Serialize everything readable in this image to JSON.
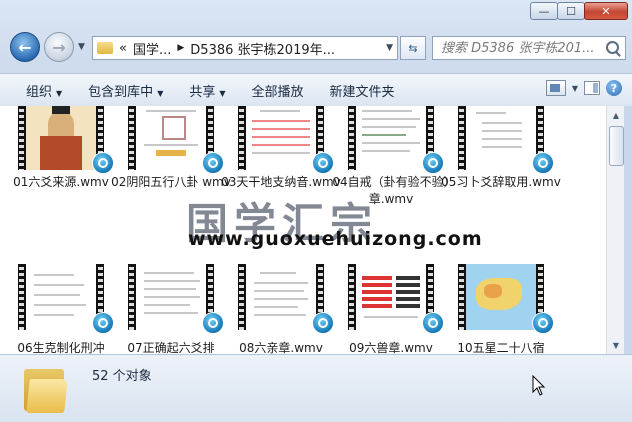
{
  "address": {
    "overflow": "«",
    "segment1": "国学...",
    "segment2": "D5386 张宇栋2019年..."
  },
  "search": {
    "placeholder": "搜索 D5386 张宇栋201..."
  },
  "toolbar": {
    "organize": "组织",
    "include_library": "包含到库中",
    "share": "共享",
    "play_all": "全部播放",
    "new_folder": "新建文件夹"
  },
  "files": [
    {
      "name": "01六爻来源.wmv"
    },
    {
      "name": "02阴阳五行八卦 wmv"
    },
    {
      "name": "03天干地支纳音.wmv"
    },
    {
      "name": "04自戒（卦有验不验）章.wmv"
    },
    {
      "name": "05习卜爻辞取用.wmv"
    },
    {
      "name": "06生克制化刑冲"
    },
    {
      "name": "07正确起六爻排"
    },
    {
      "name": "08六亲章.wmv"
    },
    {
      "name": "09六兽章.wmv"
    },
    {
      "name": "10五星二十八宿"
    }
  ],
  "watermark": {
    "text": "国学汇宗",
    "url": "www.guoxuehuizong.com"
  },
  "status": {
    "count": "52 个对象"
  },
  "colors": {
    "accent": "#2a6bb4",
    "badge": "#1679b8"
  }
}
